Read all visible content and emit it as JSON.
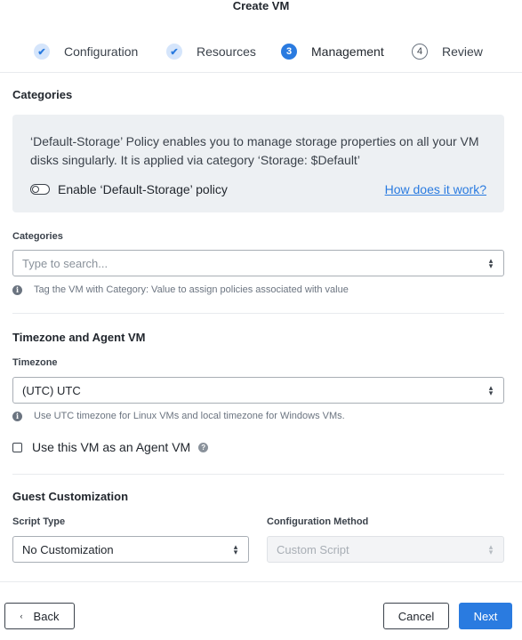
{
  "dialog": {
    "title": "Create VM"
  },
  "steps": [
    {
      "marker": "✔",
      "label": "Configuration",
      "state": "done"
    },
    {
      "marker": "✔",
      "label": "Resources",
      "state": "done"
    },
    {
      "marker": "3",
      "label": "Management",
      "state": "active"
    },
    {
      "marker": "4",
      "label": "Review",
      "state": "todo"
    }
  ],
  "categories": {
    "section_title": "Categories",
    "info_text": "‘Default-Storage’ Policy enables you to manage storage properties on all your VM disks singularly. It is applied via category ‘Storage: $Default’",
    "toggle_label": "Enable ‘Default-Storage’ policy",
    "toggle_on": false,
    "help_link": "How does it work?",
    "field_label": "Categories",
    "search_placeholder": "Type to search...",
    "hint": "Tag the VM with Category: Value to assign policies associated with value"
  },
  "timezone": {
    "section_title": "Timezone and Agent VM",
    "field_label": "Timezone",
    "value": "(UTC) UTC",
    "hint": "Use UTC timezone for Linux VMs and local timezone for Windows VMs.",
    "agent_vm_label": "Use this VM as an Agent VM",
    "agent_vm_checked": false
  },
  "guest_customization": {
    "section_title": "Guest Customization",
    "script_type_label": "Script Type",
    "script_type_value": "No Customization",
    "config_method_label": "Configuration Method",
    "config_method_value": "Custom Script"
  },
  "footer": {
    "back_label": "Back",
    "cancel_label": "Cancel",
    "next_label": "Next"
  },
  "icons": {
    "info": "info-icon",
    "help": "question-icon",
    "select_arrows": "updown-chevron-icon",
    "back_arrow": "chevron-left-icon"
  },
  "colors": {
    "accent": "#2a7be0",
    "info_box_bg": "#edf0f3",
    "step_done_bg": "#d5e5fb"
  }
}
